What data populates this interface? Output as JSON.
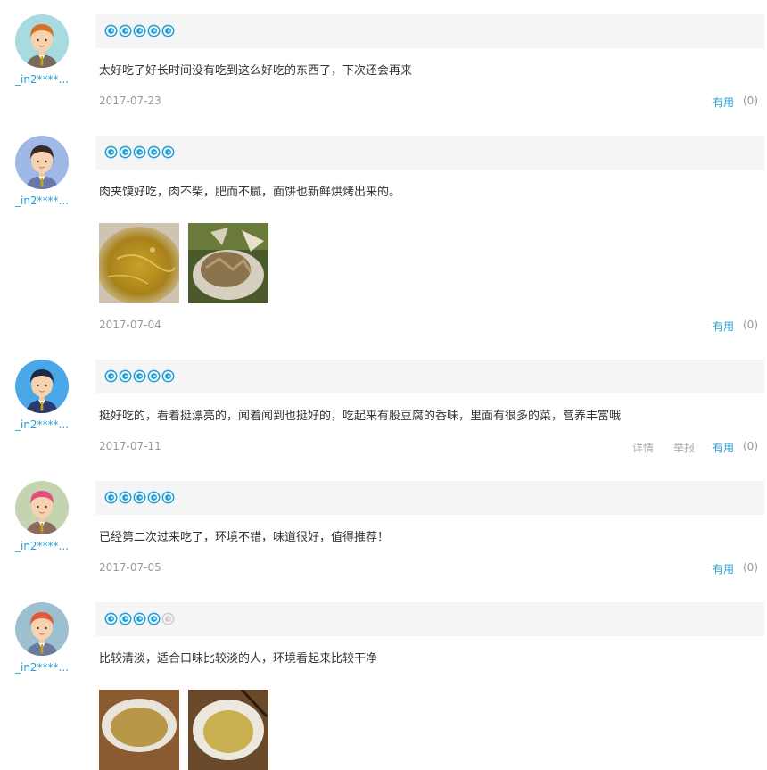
{
  "colors": {
    "accent": "#2a9fd6",
    "star_on": "#1a9fd6",
    "star_off": "#cccccc"
  },
  "reviews": [
    {
      "username": "_in2****...",
      "stars": 5,
      "content": "太好吃了好长时间没有吃到这么好吃的东西了，下次还会再来",
      "date": "2017-07-23",
      "useful_label": "有用",
      "useful_count": "(0)",
      "avatar": {
        "hair": "#d9702a",
        "bg": "#a8dbe0",
        "shirt": "#7a6a5e"
      }
    },
    {
      "username": "_in2****...",
      "stars": 5,
      "content": "肉夹馍好吃，肉不柴，肥而不腻，面饼也新鲜烘烤出来的。",
      "date": "2017-07-04",
      "useful_label": "有用",
      "useful_count": "(0)",
      "photos": [
        "photo-soup",
        "photo-meat"
      ],
      "avatar": {
        "hair": "#3a2a22",
        "bg": "#9fb8e6",
        "shirt": "#6a78a8"
      }
    },
    {
      "username": "_in2****...",
      "stars": 5,
      "content": "挺好吃的，看着挺漂亮的，闻着闻到也挺好的，吃起来有股豆腐的香味，里面有很多的菜，营养丰富哦",
      "date": "2017-07-11",
      "detail_label": "详情",
      "report_label": "举报",
      "useful_label": "有用",
      "useful_count": "(0)",
      "avatar": {
        "hair": "#1c2a4a",
        "bg": "#4aa8e8",
        "shirt": "#2a3a6a"
      }
    },
    {
      "username": "_in2****...",
      "stars": 5,
      "content": "已经第二次过来吃了，环境不错，味道很好，值得推荐！",
      "date": "2017-07-05",
      "useful_label": "有用",
      "useful_count": "(0)",
      "avatar": {
        "hair": "#e0507a",
        "bg": "#c4d4b0",
        "shirt": "#8a6a5a"
      }
    },
    {
      "username": "_in2****...",
      "stars": 4,
      "content": "比较清淡，适合口味比较淡的人，环境看起来比较干净",
      "photos": [
        "photo-bowl",
        "photo-noodles"
      ],
      "avatar": {
        "hair": "#e05a3a",
        "bg": "#9cc0cf",
        "shirt": "#6a7a9a"
      }
    }
  ]
}
